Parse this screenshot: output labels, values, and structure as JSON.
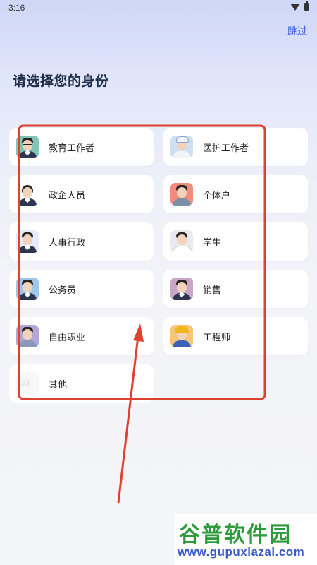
{
  "status": {
    "time": "3:16",
    "icons": [
      "wifi-icon",
      "battery-icon"
    ]
  },
  "header": {
    "skip_label": "跳过",
    "title": "请选择您的身份"
  },
  "roles": [
    {
      "label": "教育工作者",
      "avatar": "teacher-avatar-icon",
      "bg": "#7fc6b8"
    },
    {
      "label": "医护工作者",
      "avatar": "medical-worker-avatar-icon",
      "bg": "#cfe0f5"
    },
    {
      "label": "政企人员",
      "avatar": "official-avatar-icon",
      "bg": "#ffffff"
    },
    {
      "label": "个体户",
      "avatar": "self-employed-avatar-icon",
      "bg": "#f08c7c"
    },
    {
      "label": "人事行政",
      "avatar": "hr-admin-avatar-icon",
      "bg": "#e6ecfb"
    },
    {
      "label": "学生",
      "avatar": "student-avatar-icon",
      "bg": "#e9e9ee"
    },
    {
      "label": "公务员",
      "avatar": "civil-servant-avatar-icon",
      "bg": "#9cc6ea"
    },
    {
      "label": "销售",
      "avatar": "sales-avatar-icon",
      "bg": "#c9a5c7"
    },
    {
      "label": "自由职业",
      "avatar": "freelancer-avatar-icon",
      "bg": "#b3a6d6"
    },
    {
      "label": "工程师",
      "avatar": "engineer-avatar-icon",
      "bg": "#f6c77a"
    },
    {
      "label": "其他",
      "avatar": "ai-avatar-icon",
      "bg": "#f8f8fa"
    }
  ],
  "colors": {
    "accent": "#3b5bdb",
    "annotation": "#e0402f",
    "title": "#1f2d4a"
  },
  "watermark": {
    "title": "谷普软件园",
    "url": "www.gupuxlazal.com"
  }
}
